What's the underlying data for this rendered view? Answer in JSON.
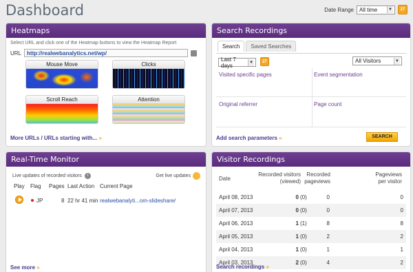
{
  "title": "Dashboard",
  "date_range": {
    "label": "Date Range",
    "value": "All time",
    "cal_day": "27"
  },
  "heatmaps": {
    "title": "Heatmaps",
    "instructions": "Select URL and click one of the Heatmap buttons to view the Heatmap Report",
    "url_label": "URL",
    "url_value": "http://realwebanalytics.net/wp/",
    "buttons": [
      "Mouse Move",
      "Clicks",
      "Scroll Reach",
      "Attention"
    ],
    "more_link": "More URLs / URLs starting with...",
    "more_chev": "»"
  },
  "search": {
    "title": "Search Recordings",
    "tabs": [
      "Search",
      "Saved Searches"
    ],
    "days": "Last 7 days",
    "visitors": "All Visitors",
    "cal_day": "27",
    "cells": [
      "Visited specific pages",
      "Event segmentation",
      "Original referrer",
      "Page count"
    ],
    "add_params": "Add search parameters",
    "add_chev": "»",
    "button": "SEARCH"
  },
  "realtime": {
    "title": "Real-Time Monitor",
    "subtitle": "Live updates of recorded visitors",
    "live_label": "Get live updates",
    "headers": [
      "Play",
      "Flag",
      "Pages",
      "Last Action",
      "Current Page"
    ],
    "row": {
      "flag": "JP",
      "pages": "8",
      "last_action": "22 hr 41 min",
      "page": "realwebanalyti...om-slideshare/"
    },
    "see_more": "See more",
    "see_chev": "»"
  },
  "visitor_rec": {
    "title": "Visitor Recordings",
    "headers": {
      "date": "Date",
      "recorded": "Recorded visitors",
      "viewed": "(viewed)",
      "pageviews1": "Recorded",
      "pageviews2": "pageviews",
      "ppv1": "Pageviews",
      "ppv2": "per visitor"
    },
    "rows": [
      {
        "date": "April 08, 2013",
        "rec": "0",
        "viewed": "(0)",
        "pv": "0",
        "ppv": "0"
      },
      {
        "date": "April 07, 2013",
        "rec": "0",
        "viewed": "(0)",
        "pv": "0",
        "ppv": "0"
      },
      {
        "date": "April 06, 2013",
        "rec": "1",
        "viewed": "(1)",
        "pv": "8",
        "ppv": "8"
      },
      {
        "date": "April 05, 2013",
        "rec": "1",
        "viewed": "(0)",
        "pv": "2",
        "ppv": "2"
      },
      {
        "date": "April 04, 2013",
        "rec": "1",
        "viewed": "(0)",
        "pv": "1",
        "ppv": "1"
      },
      {
        "date": "April 03, 2013",
        "rec": "2",
        "viewed": "(0)",
        "pv": "4",
        "ppv": "2"
      }
    ],
    "footer": "Search recordings",
    "footer_chev": "»"
  }
}
